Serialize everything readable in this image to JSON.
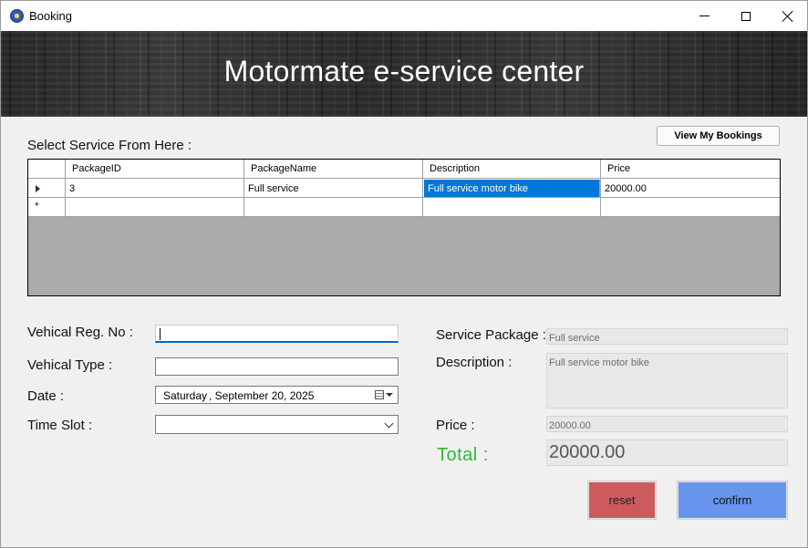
{
  "window": {
    "title": "Booking",
    "icon": "app-gear-icon"
  },
  "header": {
    "title": "Motormate e-service center"
  },
  "service_section": {
    "label": "Select Service From Here :",
    "view_bookings_label": "View My Bookings"
  },
  "grid": {
    "columns": [
      "PackageID",
      "PackageName",
      "Description",
      "Price"
    ],
    "rows": [
      [
        "3",
        "Full service",
        "Full service motor bike",
        "20000.00"
      ]
    ],
    "new_row_marker": "*"
  },
  "form": {
    "reg_no_label": "Vehical Reg. No :",
    "reg_no_value": "",
    "type_label": "Vehical Type :",
    "type_value": "",
    "date_label": "Date :",
    "date_day": "Saturday",
    "date_rest": ", September 20, 2025",
    "time_slot_label": "Time Slot :",
    "time_slot_value": ""
  },
  "summary": {
    "package_label": "Service Package :",
    "package_value": "Full service",
    "description_label": "Description :",
    "description_value": "Full service motor bike",
    "price_label": "Price :",
    "price_value": "20000.00",
    "total_label": "Total :",
    "total_value": "20000.00"
  },
  "actions": {
    "reset_label": "reset",
    "confirm_label": "confirm"
  },
  "colors": {
    "selection": "#0078d7",
    "total_label": "#2ebb2e",
    "reset_button": "#cd5b5e",
    "confirm_button": "#6795ee"
  }
}
